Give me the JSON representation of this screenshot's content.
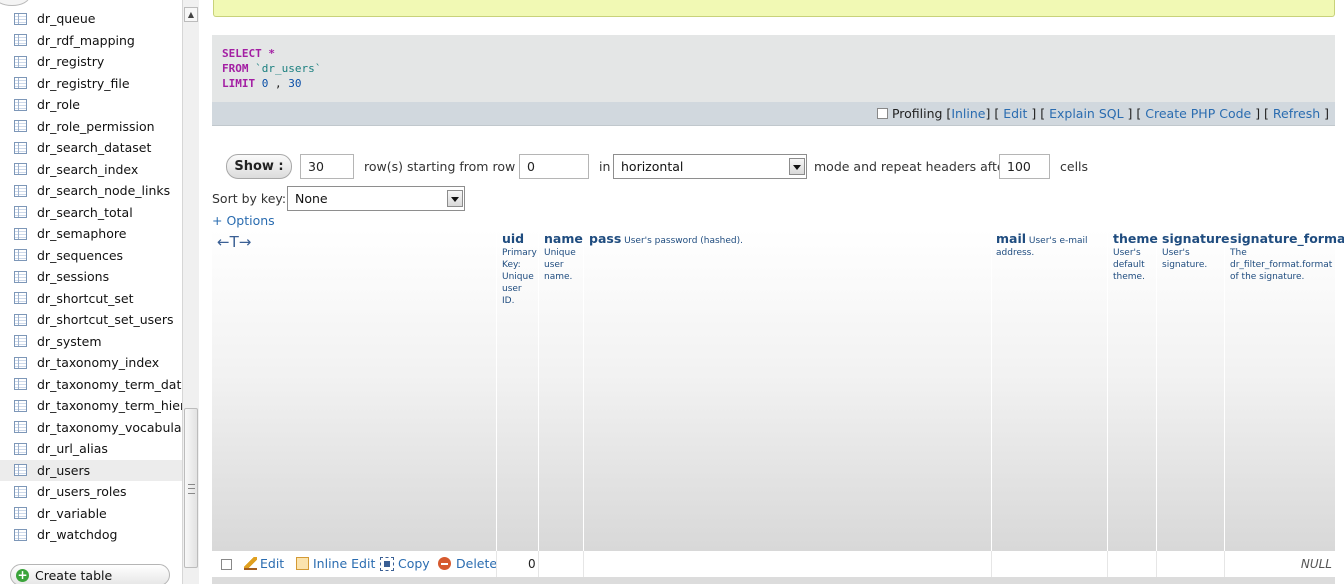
{
  "sidebar": {
    "tables": [
      {
        "label": "dr_queue"
      },
      {
        "label": "dr_rdf_mapping"
      },
      {
        "label": "dr_registry"
      },
      {
        "label": "dr_registry_file"
      },
      {
        "label": "dr_role"
      },
      {
        "label": "dr_role_permission"
      },
      {
        "label": "dr_search_dataset"
      },
      {
        "label": "dr_search_index"
      },
      {
        "label": "dr_search_node_links"
      },
      {
        "label": "dr_search_total"
      },
      {
        "label": "dr_semaphore"
      },
      {
        "label": "dr_sequences"
      },
      {
        "label": "dr_sessions"
      },
      {
        "label": "dr_shortcut_set"
      },
      {
        "label": "dr_shortcut_set_users"
      },
      {
        "label": "dr_system"
      },
      {
        "label": "dr_taxonomy_index"
      },
      {
        "label": "dr_taxonomy_term_data"
      },
      {
        "label": "dr_taxonomy_term_hiera"
      },
      {
        "label": "dr_taxonomy_vocabulary"
      },
      {
        "label": "dr_url_alias"
      },
      {
        "label": "dr_users"
      },
      {
        "label": "dr_users_roles"
      },
      {
        "label": "dr_variable"
      },
      {
        "label": "dr_watchdog"
      }
    ],
    "active_table": "dr_users",
    "create_table_label": "Create table"
  },
  "sql": {
    "select_kw": "SELECT",
    "select_rest": " *",
    "from_kw": "FROM",
    "from_table": " `dr_users`",
    "limit_kw": "LIMIT",
    "limit_offset": " 0",
    "limit_sep": " , ",
    "limit_count": "30"
  },
  "sql_toolbar": {
    "profiling_label": "Profiling",
    "inline": "Inline",
    "edit": "Edit",
    "explain": "Explain SQL",
    "create_php": "Create PHP Code",
    "refresh": "Refresh"
  },
  "navigation": {
    "show_label": "Show :",
    "rows_value": "30",
    "rows_label": "row(s) starting from row #",
    "start_value": "0",
    "in_label": "in",
    "mode_value": "horizontal",
    "mode_label": "mode and repeat headers after",
    "repeat_value": "100",
    "cells_label": "cells",
    "sort_label": "Sort by key:",
    "sort_value": "None",
    "options_label": "+ Options"
  },
  "columns": [
    {
      "name": "uid",
      "comment": "Primary Key: Unique user ID."
    },
    {
      "name": "name",
      "comment": "Unique user name."
    },
    {
      "name": "pass",
      "comment": "User's password (hashed)."
    },
    {
      "name": "mail",
      "comment": "User's e-mail address."
    },
    {
      "name": "theme",
      "comment": "User's default theme."
    },
    {
      "name": "signature",
      "comment": "User's signature."
    },
    {
      "name": "signature_format",
      "comment": "The dr_filter_format.format of the signature."
    }
  ],
  "arrows_glyph": "←T→",
  "row": {
    "edit": "Edit",
    "inline_edit": "Inline Edit",
    "copy": "Copy",
    "delete": "Delete",
    "uid": "0",
    "signature_format": "NULL"
  }
}
